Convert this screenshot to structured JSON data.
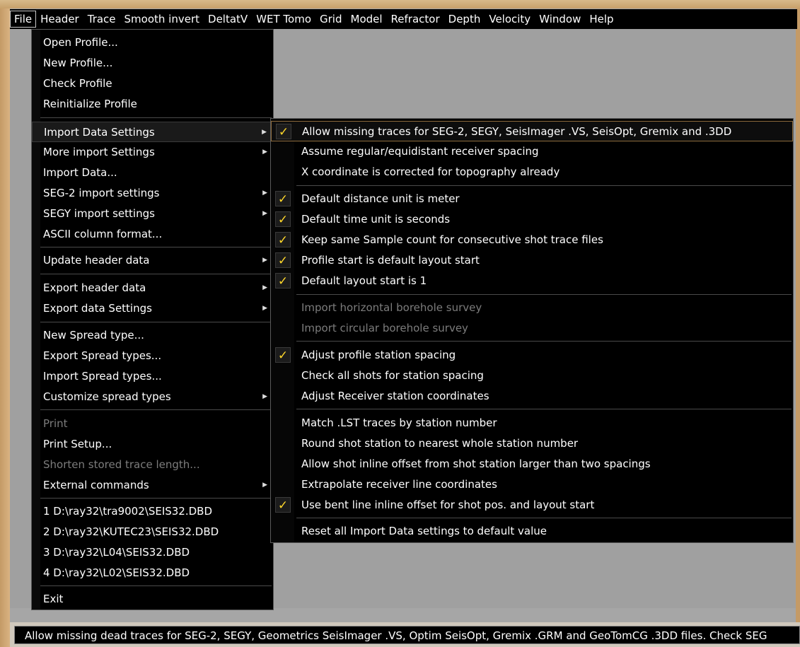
{
  "menubar": {
    "items": [
      "File",
      "Header",
      "Trace",
      "Smooth invert",
      "DeltatV",
      "WET Tomo",
      "Grid",
      "Model",
      "Refractor",
      "Depth",
      "Velocity",
      "Window",
      "Help"
    ]
  },
  "file_menu": {
    "items": [
      {
        "label": "Open Profile..."
      },
      {
        "label": "New Profile..."
      },
      {
        "label": "Check Profile"
      },
      {
        "label": "Reinitialize Profile"
      },
      {
        "label": "Import Data Settings",
        "submenu": true,
        "state": "open"
      },
      {
        "label": "More import Settings",
        "submenu": true
      },
      {
        "label": "Import Data..."
      },
      {
        "label": "SEG-2 import settings",
        "submenu": true
      },
      {
        "label": "SEGY import settings",
        "submenu": true
      },
      {
        "label": "ASCII column format..."
      },
      {
        "label": "Update header data",
        "submenu": true
      },
      {
        "label": "Export header data",
        "submenu": true
      },
      {
        "label": "Export data Settings",
        "submenu": true
      },
      {
        "label": "New Spread type..."
      },
      {
        "label": "Export Spread types..."
      },
      {
        "label": "Import Spread types..."
      },
      {
        "label": "Customize spread types",
        "submenu": true
      },
      {
        "label": "Print",
        "disabled": true
      },
      {
        "label": "Print Setup..."
      },
      {
        "label": "Shorten stored trace length...",
        "disabled": true
      },
      {
        "label": "External commands",
        "submenu": true
      },
      {
        "label": "1 D:\\ray32\\tra9002\\SEIS32.DBD"
      },
      {
        "label": "2 D:\\ray32\\KUTEC23\\SEIS32.DBD"
      },
      {
        "label": "3 D:\\ray32\\L04\\SEIS32.DBD"
      },
      {
        "label": "4 D:\\ray32\\L02\\SEIS32.DBD"
      },
      {
        "label": "Exit"
      }
    ]
  },
  "import_settings_menu": {
    "check_glyph": "✓",
    "items": [
      {
        "label": "Allow missing traces for SEG-2, SEGY, SeisImager .VS, SeisOpt, Gremix and .3DD",
        "checked": true
      },
      {
        "label": "Assume regular/equidistant receiver spacing",
        "checked": false
      },
      {
        "label": "X coordinate is corrected for topography already",
        "checked": false
      },
      {
        "label": "Default distance unit is meter",
        "checked": true
      },
      {
        "label": "Default time unit is seconds",
        "checked": true
      },
      {
        "label": "Keep same Sample count for consecutive shot trace files",
        "checked": true
      },
      {
        "label": "Profile start is default layout start",
        "checked": true
      },
      {
        "label": "Default layout start is 1",
        "checked": true
      },
      {
        "label": "Import horizontal borehole survey",
        "checked": false,
        "disabled": true
      },
      {
        "label": "Import circular borehole survey",
        "checked": false,
        "disabled": true
      },
      {
        "label": "Adjust profile station spacing",
        "checked": true
      },
      {
        "label": "Check all shots for station spacing",
        "checked": false
      },
      {
        "label": "Adjust Receiver station coordinates",
        "checked": false
      },
      {
        "label": "Match .LST traces by station number",
        "checked": false
      },
      {
        "label": "Round shot station to nearest whole station number",
        "checked": false
      },
      {
        "label": "Allow shot inline offset from shot station larger than two spacings",
        "checked": false
      },
      {
        "label": "Extrapolate receiver line coordinates",
        "checked": false
      },
      {
        "label": "Use bent line inline offset for shot pos. and layout start",
        "checked": true
      },
      {
        "label": "Reset all Import Data settings to default value",
        "checked": false
      }
    ]
  },
  "status_bar": {
    "text": "Allow missing dead traces for SEG-2, SEGY, Geometrics SeisImager .VS, Optim SeisOpt, Gremix .GRM and GeoTomCG .3DD files. Check SEG"
  }
}
